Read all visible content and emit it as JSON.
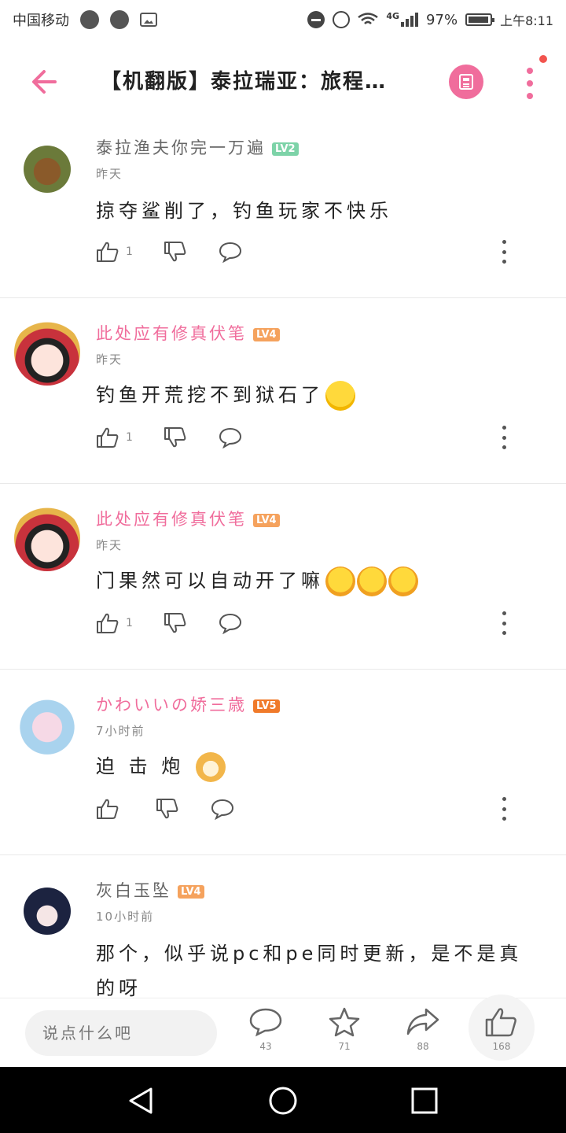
{
  "status_bar": {
    "carrier": "中国移动",
    "network": "4G",
    "battery": "97%",
    "time": "上午8:11"
  },
  "header": {
    "title": "【机翻版】泰拉瑞亚：旅程…",
    "back_icon": "back-arrow-icon",
    "doc_icon": "article-icon",
    "more_icon": "more-vertical-icon",
    "accent_color": "#f06d9c"
  },
  "comments": [
    {
      "username": "泰拉渔夫你完一万遍",
      "level": "LV2",
      "level_color": "#7dd3a8",
      "name_color": "#666666",
      "time": "昨天",
      "text": "掠夺鲨削了，钓鱼玩家不快乐",
      "emojis": [],
      "likes": "1"
    },
    {
      "username": "此处应有修真伏笔",
      "level": "LV4",
      "level_color": "#f5a25d",
      "name_color": "#f06d9c",
      "time": "昨天",
      "text": "钓鱼开荒挖不到狱石了",
      "emojis": [
        "crying-laughing-emoji"
      ],
      "likes": "1"
    },
    {
      "username": "此处应有修真伏笔",
      "level": "LV4",
      "level_color": "#f5a25d",
      "name_color": "#f06d9c",
      "time": "昨天",
      "text": "门果然可以自动开了嘛",
      "emojis": [
        "cheering-emoji",
        "cheering-emoji",
        "cheering-emoji"
      ],
      "likes": "1"
    },
    {
      "username": "かわいいの娇三歳",
      "level": "LV5",
      "level_color": "#f07a2a",
      "name_color": "#f06d9c",
      "time": "7小时前",
      "text": "迫 击 炮",
      "emojis": [
        "doge-emoji"
      ],
      "likes": ""
    },
    {
      "username": "灰白玉坠",
      "level": "LV4",
      "level_color": "#f5a25d",
      "name_color": "#666666",
      "time": "10小时前",
      "text": "那个，似乎说pc和pe同时更新，是不是真的呀",
      "emojis": [],
      "likes": ""
    }
  ],
  "bottom_bar": {
    "input_placeholder": "说点什么吧",
    "comments_count": "43",
    "favorites_count": "71",
    "shares_count": "88",
    "likes_count": "168"
  }
}
